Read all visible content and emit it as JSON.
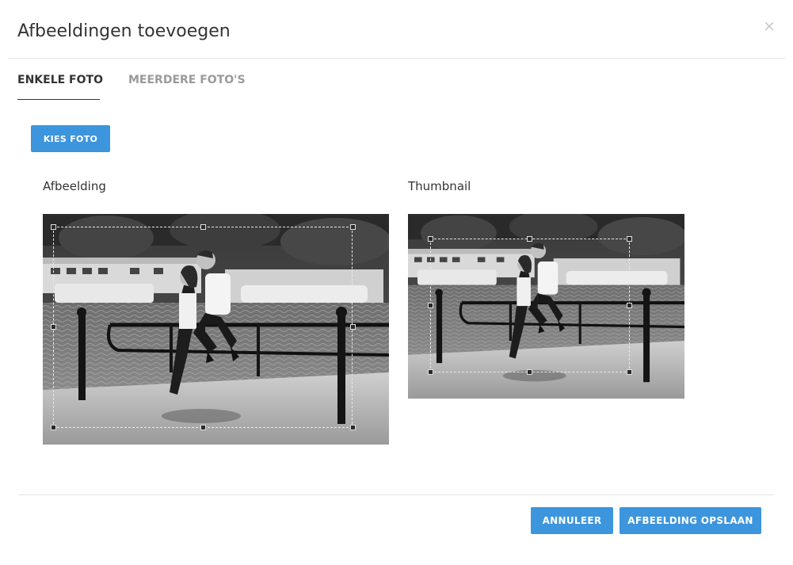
{
  "modal": {
    "title": "Afbeeldingen toevoegen",
    "close_symbol": "×"
  },
  "tabs": [
    {
      "label": "ENKELE FOTO",
      "active": true
    },
    {
      "label": "MEERDERE FOTO'S",
      "active": false
    }
  ],
  "choose_button": {
    "label": "KIES FOTO"
  },
  "image_panel": {
    "label": "Afbeelding"
  },
  "thumbnail_panel": {
    "label": "Thumbnail"
  },
  "footer": {
    "cancel_label": "ANNULEER",
    "save_label": "AFBEELDING OPSLAAN"
  },
  "colors": {
    "primary_button": "#3c95dd",
    "close_icon": "#c6c6c6",
    "inactive_tab": "#9a9a9a"
  },
  "icons": {
    "close": "close-icon",
    "crop_handles": "crop-handle-icon"
  }
}
